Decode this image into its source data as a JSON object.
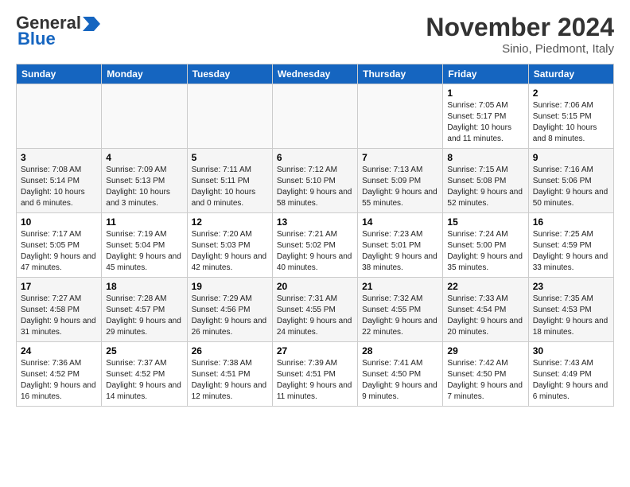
{
  "header": {
    "logo_general": "General",
    "logo_blue": "Blue",
    "month_title": "November 2024",
    "location": "Sinio, Piedmont, Italy"
  },
  "weekdays": [
    "Sunday",
    "Monday",
    "Tuesday",
    "Wednesday",
    "Thursday",
    "Friday",
    "Saturday"
  ],
  "weeks": [
    [
      {
        "day": "",
        "info": ""
      },
      {
        "day": "",
        "info": ""
      },
      {
        "day": "",
        "info": ""
      },
      {
        "day": "",
        "info": ""
      },
      {
        "day": "",
        "info": ""
      },
      {
        "day": "1",
        "info": "Sunrise: 7:05 AM\nSunset: 5:17 PM\nDaylight: 10 hours and 11 minutes."
      },
      {
        "day": "2",
        "info": "Sunrise: 7:06 AM\nSunset: 5:15 PM\nDaylight: 10 hours and 8 minutes."
      }
    ],
    [
      {
        "day": "3",
        "info": "Sunrise: 7:08 AM\nSunset: 5:14 PM\nDaylight: 10 hours and 6 minutes."
      },
      {
        "day": "4",
        "info": "Sunrise: 7:09 AM\nSunset: 5:13 PM\nDaylight: 10 hours and 3 minutes."
      },
      {
        "day": "5",
        "info": "Sunrise: 7:11 AM\nSunset: 5:11 PM\nDaylight: 10 hours and 0 minutes."
      },
      {
        "day": "6",
        "info": "Sunrise: 7:12 AM\nSunset: 5:10 PM\nDaylight: 9 hours and 58 minutes."
      },
      {
        "day": "7",
        "info": "Sunrise: 7:13 AM\nSunset: 5:09 PM\nDaylight: 9 hours and 55 minutes."
      },
      {
        "day": "8",
        "info": "Sunrise: 7:15 AM\nSunset: 5:08 PM\nDaylight: 9 hours and 52 minutes."
      },
      {
        "day": "9",
        "info": "Sunrise: 7:16 AM\nSunset: 5:06 PM\nDaylight: 9 hours and 50 minutes."
      }
    ],
    [
      {
        "day": "10",
        "info": "Sunrise: 7:17 AM\nSunset: 5:05 PM\nDaylight: 9 hours and 47 minutes."
      },
      {
        "day": "11",
        "info": "Sunrise: 7:19 AM\nSunset: 5:04 PM\nDaylight: 9 hours and 45 minutes."
      },
      {
        "day": "12",
        "info": "Sunrise: 7:20 AM\nSunset: 5:03 PM\nDaylight: 9 hours and 42 minutes."
      },
      {
        "day": "13",
        "info": "Sunrise: 7:21 AM\nSunset: 5:02 PM\nDaylight: 9 hours and 40 minutes."
      },
      {
        "day": "14",
        "info": "Sunrise: 7:23 AM\nSunset: 5:01 PM\nDaylight: 9 hours and 38 minutes."
      },
      {
        "day": "15",
        "info": "Sunrise: 7:24 AM\nSunset: 5:00 PM\nDaylight: 9 hours and 35 minutes."
      },
      {
        "day": "16",
        "info": "Sunrise: 7:25 AM\nSunset: 4:59 PM\nDaylight: 9 hours and 33 minutes."
      }
    ],
    [
      {
        "day": "17",
        "info": "Sunrise: 7:27 AM\nSunset: 4:58 PM\nDaylight: 9 hours and 31 minutes."
      },
      {
        "day": "18",
        "info": "Sunrise: 7:28 AM\nSunset: 4:57 PM\nDaylight: 9 hours and 29 minutes."
      },
      {
        "day": "19",
        "info": "Sunrise: 7:29 AM\nSunset: 4:56 PM\nDaylight: 9 hours and 26 minutes."
      },
      {
        "day": "20",
        "info": "Sunrise: 7:31 AM\nSunset: 4:55 PM\nDaylight: 9 hours and 24 minutes."
      },
      {
        "day": "21",
        "info": "Sunrise: 7:32 AM\nSunset: 4:55 PM\nDaylight: 9 hours and 22 minutes."
      },
      {
        "day": "22",
        "info": "Sunrise: 7:33 AM\nSunset: 4:54 PM\nDaylight: 9 hours and 20 minutes."
      },
      {
        "day": "23",
        "info": "Sunrise: 7:35 AM\nSunset: 4:53 PM\nDaylight: 9 hours and 18 minutes."
      }
    ],
    [
      {
        "day": "24",
        "info": "Sunrise: 7:36 AM\nSunset: 4:52 PM\nDaylight: 9 hours and 16 minutes."
      },
      {
        "day": "25",
        "info": "Sunrise: 7:37 AM\nSunset: 4:52 PM\nDaylight: 9 hours and 14 minutes."
      },
      {
        "day": "26",
        "info": "Sunrise: 7:38 AM\nSunset: 4:51 PM\nDaylight: 9 hours and 12 minutes."
      },
      {
        "day": "27",
        "info": "Sunrise: 7:39 AM\nSunset: 4:51 PM\nDaylight: 9 hours and 11 minutes."
      },
      {
        "day": "28",
        "info": "Sunrise: 7:41 AM\nSunset: 4:50 PM\nDaylight: 9 hours and 9 minutes."
      },
      {
        "day": "29",
        "info": "Sunrise: 7:42 AM\nSunset: 4:50 PM\nDaylight: 9 hours and 7 minutes."
      },
      {
        "day": "30",
        "info": "Sunrise: 7:43 AM\nSunset: 4:49 PM\nDaylight: 9 hours and 6 minutes."
      }
    ]
  ]
}
